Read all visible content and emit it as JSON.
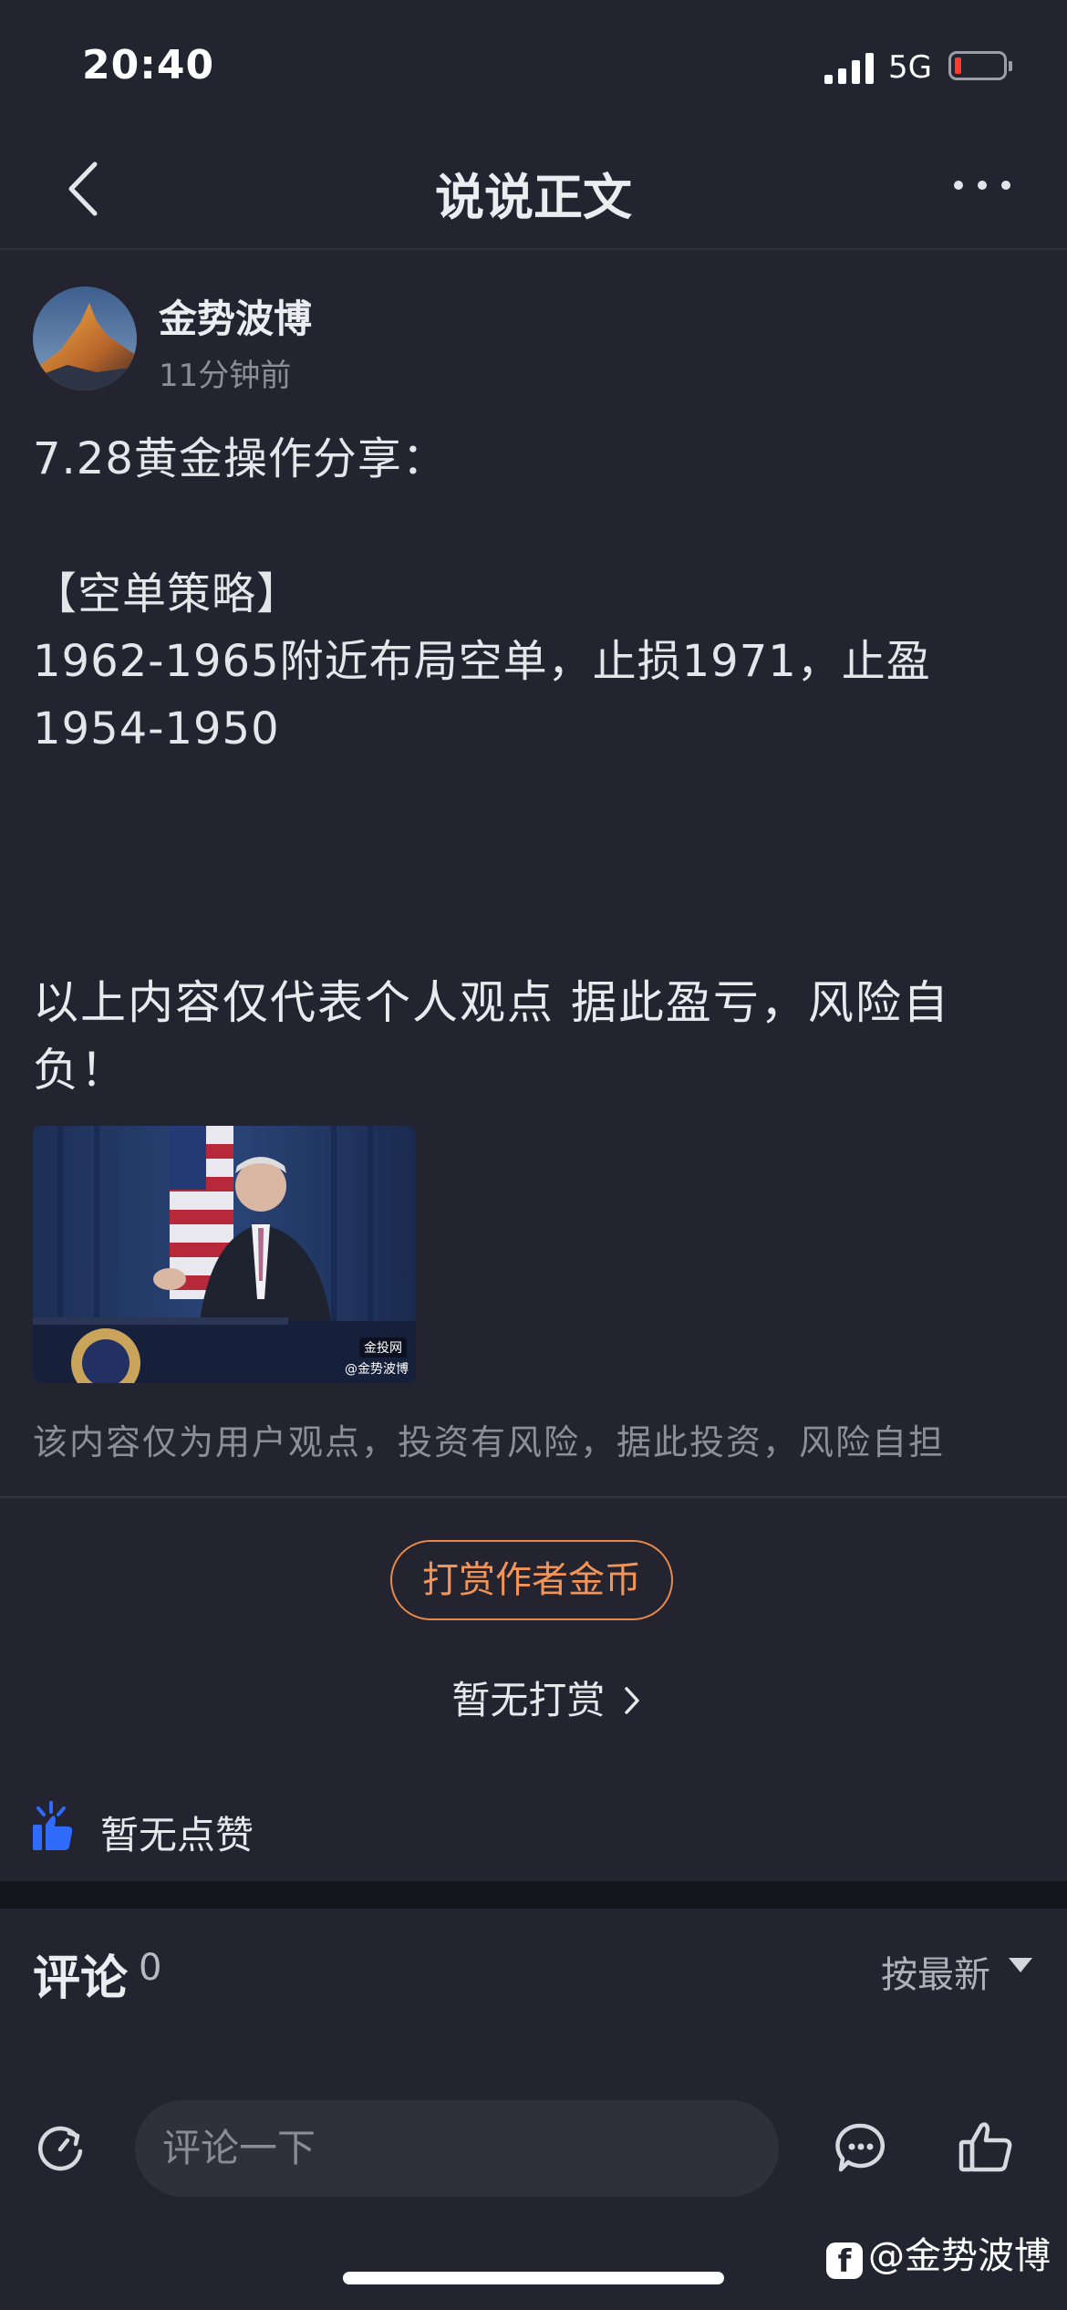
{
  "status_bar": {
    "time": "20:40",
    "network": "5G",
    "battery_level": 0.1
  },
  "nav": {
    "title": "说说正文",
    "back_icon": "chevron-left-icon",
    "more_icon": "ellipsis-icon"
  },
  "author": {
    "name": "金势波博",
    "time": "11分钟前"
  },
  "post": {
    "lines": [
      "7.28黄金操作分享：",
      "",
      "【空单策略】",
      "1962-1965附近布局空单，止损1971，止盈1954-1950"
    ],
    "disclaimer": "以上内容仅代表个人观点 据此盈亏，风险自负！",
    "image_watermark": "金投网",
    "image_credit": "@金势波博"
  },
  "risk_note": "该内容仅为用户观点，投资有风险，据此投资，风险自担",
  "tip": {
    "button_label": "打赏作者金币",
    "status": "暂无打赏"
  },
  "likes": {
    "label": "暂无点赞"
  },
  "comments": {
    "title": "评论",
    "count": "0",
    "sort_label": "按最新"
  },
  "bottom_bar": {
    "input_placeholder": "评论一下"
  },
  "watermark": "@金势波博",
  "colors": {
    "background": "#23242f",
    "accent": "#f29457",
    "like": "#2f6bff"
  }
}
